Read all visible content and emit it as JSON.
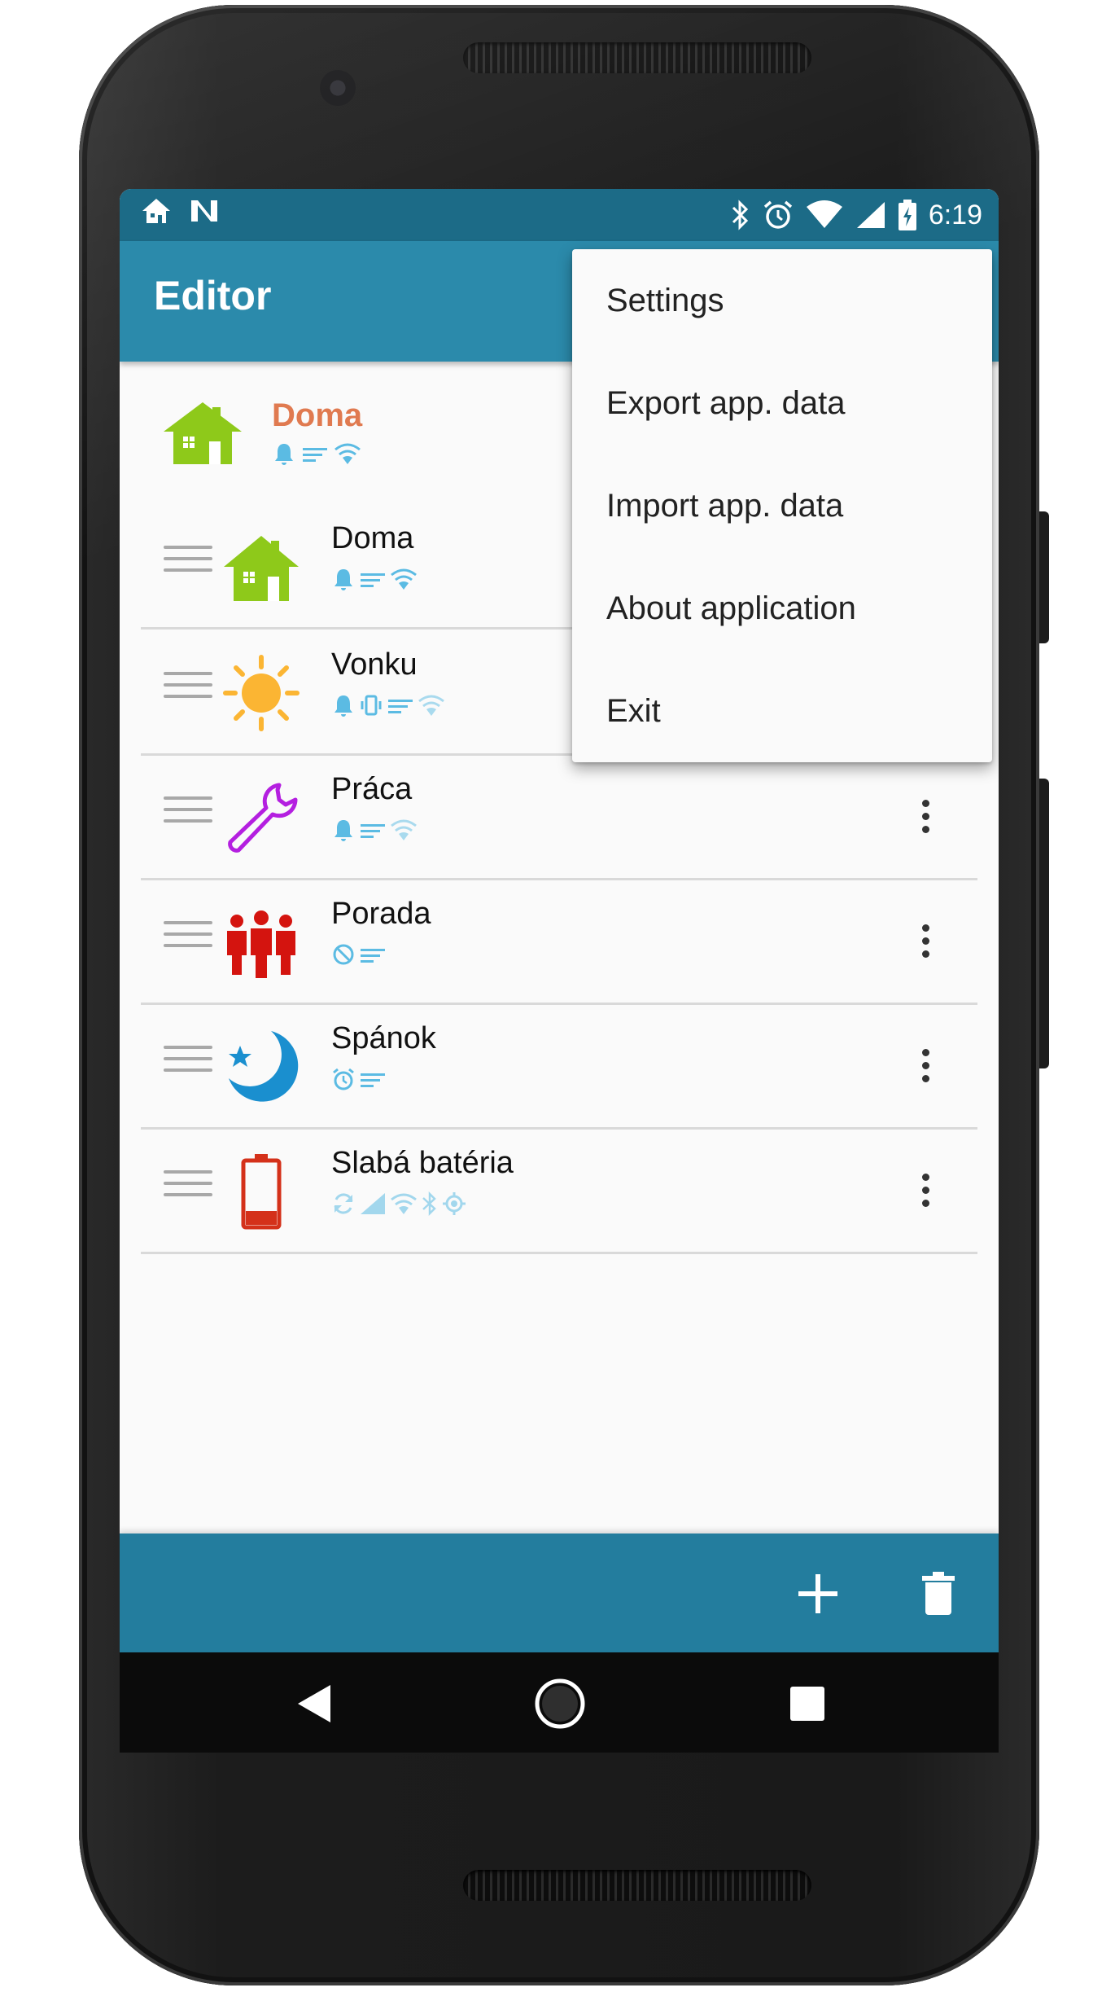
{
  "status_bar": {
    "left_icons": [
      "home-icon",
      "n-icon"
    ],
    "right_icons": [
      "bluetooth-icon",
      "alarm-icon",
      "wifi-icon",
      "signal-icon",
      "battery-charging-icon"
    ],
    "time": "6:19"
  },
  "toolbar": {
    "title": "Editor"
  },
  "activated_profile": {
    "name": "Doma",
    "name_color": "#e07a50",
    "icon": "house-icon",
    "indicators": [
      "bell-icon",
      "notes-icon",
      "wifi-icon"
    ]
  },
  "profiles": [
    {
      "name": "Doma",
      "icon": "house-icon",
      "indicators": [
        "bell-icon",
        "notes-icon",
        "wifi-icon"
      ]
    },
    {
      "name": "Vonku",
      "icon": "sun-icon",
      "indicators": [
        "bell-icon",
        "vibrate-icon",
        "notes-icon",
        "wifi-icon"
      ]
    },
    {
      "name": "Práca",
      "icon": "wrench-icon",
      "indicators": [
        "bell-icon",
        "notes-icon",
        "wifi-icon"
      ]
    },
    {
      "name": "Porada",
      "icon": "people-icon",
      "indicators": [
        "mute-icon",
        "notes-icon"
      ]
    },
    {
      "name": "Spánok",
      "icon": "moon-icon",
      "indicators": [
        "alarm-icon",
        "notes-icon"
      ]
    },
    {
      "name": "Slabá batéria",
      "icon": "battery-low-icon",
      "indicators": [
        "sync-icon",
        "signal-icon",
        "wifi-icon",
        "bluetooth-icon",
        "gps-icon"
      ]
    }
  ],
  "overflow_menu": {
    "items": [
      "Settings",
      "Export app. data",
      "Import app. data",
      "About application",
      "Exit"
    ]
  },
  "bottom_bar": {
    "actions": [
      "add-icon",
      "delete-icon"
    ]
  },
  "nav_bar": {
    "buttons": [
      "back-icon",
      "home-icon",
      "recents-icon"
    ]
  },
  "colors": {
    "status_bar": "#1c6b87",
    "toolbar": "#2b8aab",
    "bottom_bar": "#237d9e",
    "indicator": "#5bbbe3"
  }
}
